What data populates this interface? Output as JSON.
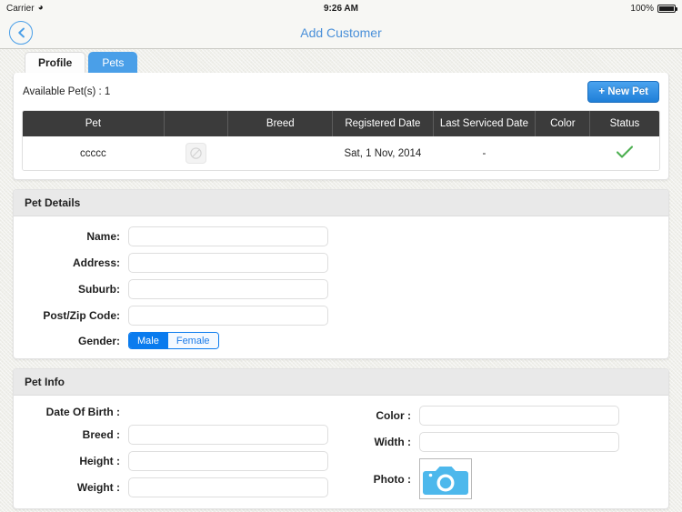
{
  "status_bar": {
    "carrier": "Carrier",
    "wifi_icon": "wifi-icon",
    "time": "9:26 AM",
    "battery_percent": "100%",
    "battery_icon": "battery-full-icon"
  },
  "navbar": {
    "back_icon": "chevron-left-circle-icon",
    "title": "Add Customer",
    "title_color": "#4a90d9"
  },
  "tabs": [
    {
      "label": "Profile",
      "active": false
    },
    {
      "label": "Pets",
      "active": true
    }
  ],
  "pets_panel": {
    "available_label": "Available Pet(s) : 1",
    "new_pet_button": "+ New Pet",
    "accent_color": "#4a9fe8",
    "columns": [
      "Pet",
      "",
      "Breed",
      "Registered Date",
      "Last Serviced Date",
      "Color",
      "Status"
    ],
    "rows": [
      {
        "pet": "ccccc",
        "thumbnail_icon": "no-image-placeholder-icon",
        "breed": "",
        "registered_date": "Sat, 1 Nov, 2014",
        "last_serviced_date": "-",
        "color": "",
        "status_icon": "green-check-icon",
        "status_color": "#4caf50"
      }
    ]
  },
  "pet_details": {
    "header": "Pet Details",
    "fields": [
      {
        "label": "Name:",
        "value": "",
        "placeholder": ""
      },
      {
        "label": "Address:",
        "value": "",
        "placeholder": ""
      },
      {
        "label": "Suburb:",
        "value": "",
        "placeholder": ""
      },
      {
        "label": "Post/Zip Code:",
        "value": "",
        "placeholder": ""
      }
    ],
    "gender": {
      "label": "Gender:",
      "options": [
        "Male",
        "Female"
      ],
      "selected": "Male",
      "selected_color": "#0a7bee"
    }
  },
  "pet_info": {
    "header": "Pet Info",
    "left_fields": [
      {
        "label": "Date Of Birth :",
        "value": "",
        "type": "text-display"
      },
      {
        "label": "Breed :",
        "value": "",
        "placeholder": ""
      },
      {
        "label": "Height :",
        "value": "",
        "placeholder": ""
      },
      {
        "label": "Weight :",
        "value": "",
        "placeholder": ""
      }
    ],
    "right_fields": [
      {
        "label": "Color :",
        "value": "",
        "placeholder": ""
      },
      {
        "label": "Width :",
        "value": "",
        "placeholder": ""
      }
    ],
    "photo": {
      "label": "Photo :",
      "icon": "camera-icon",
      "icon_color": "#4db8ec"
    }
  }
}
